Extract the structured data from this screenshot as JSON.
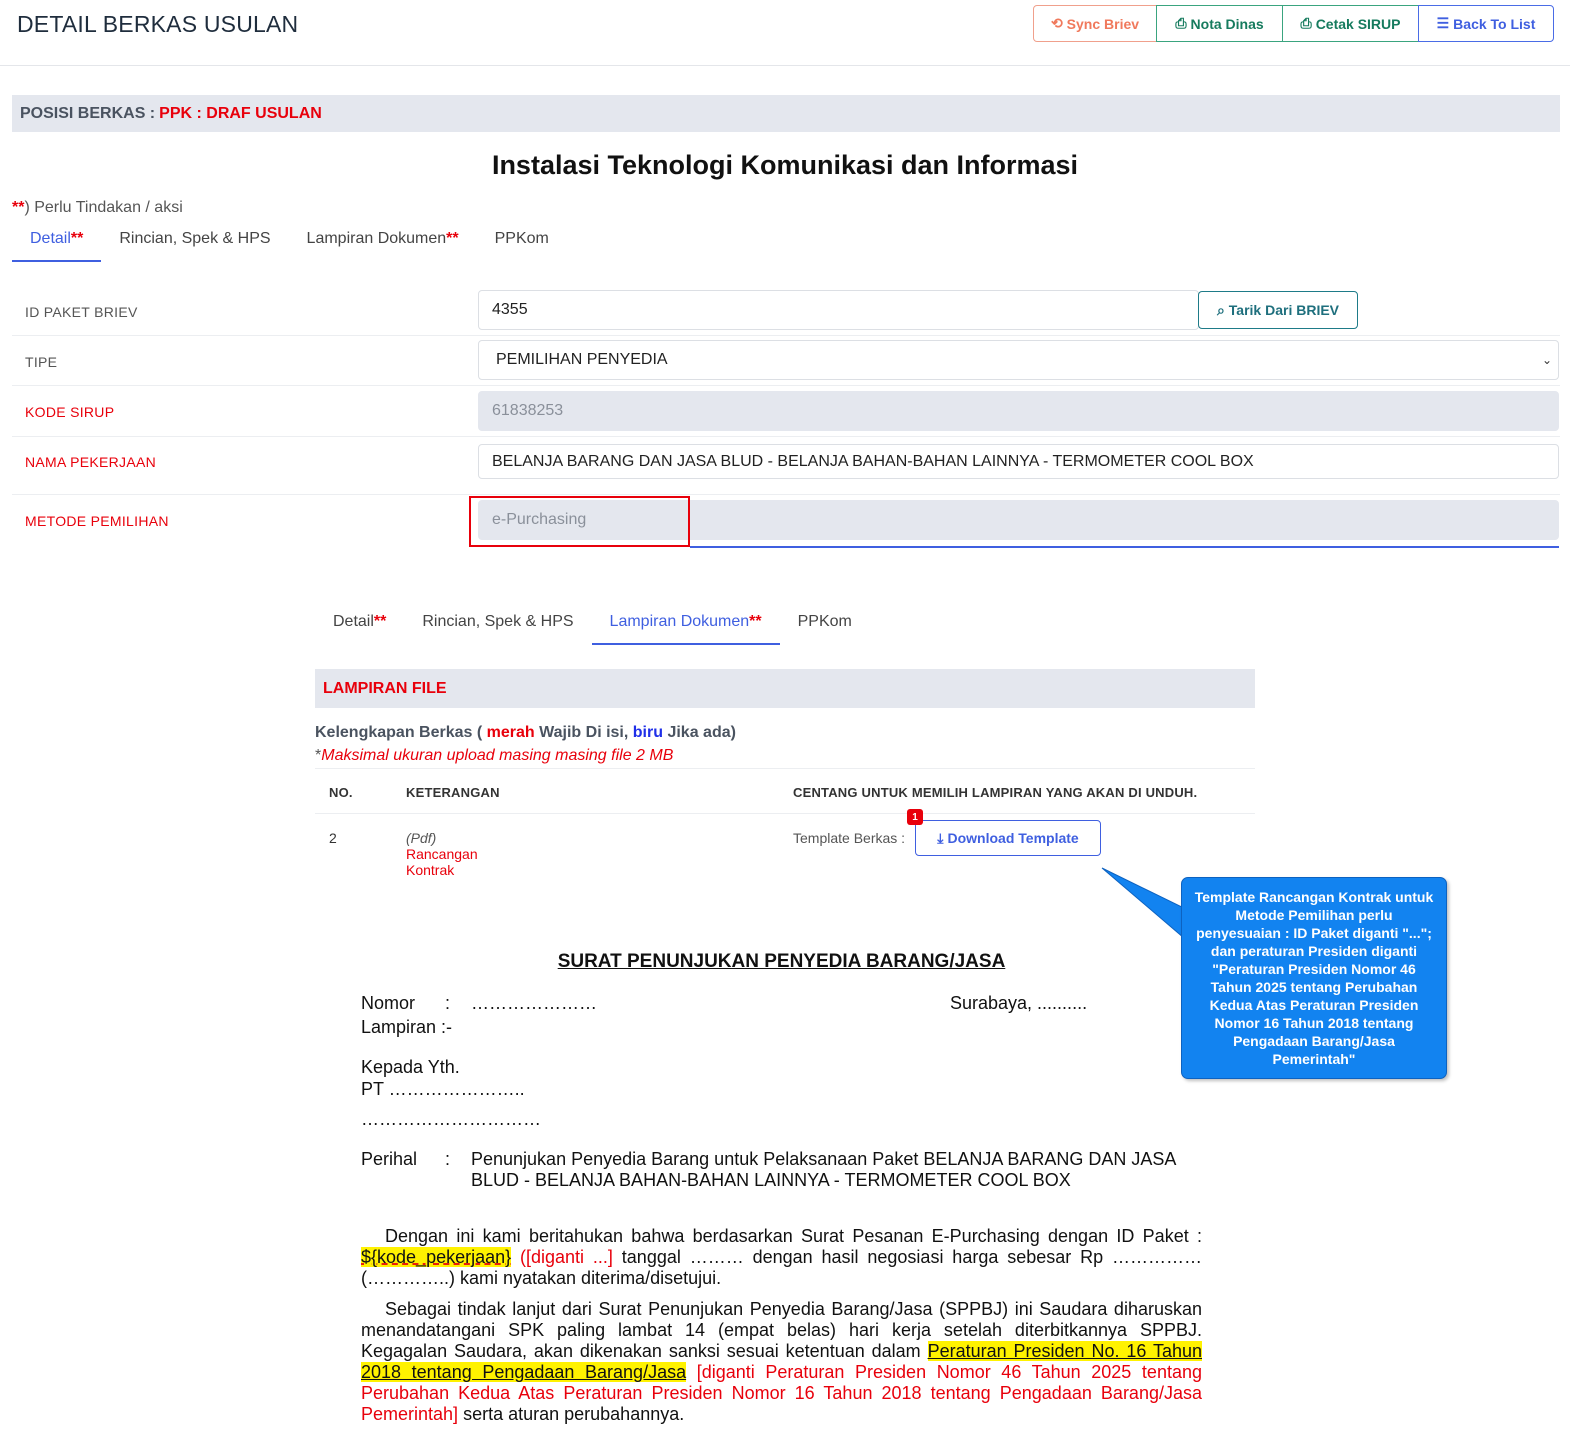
{
  "header": {
    "title": "DETAIL BERKAS USULAN",
    "buttons": {
      "sync": "Sync Briev",
      "nota": "Nota Dinas",
      "sirup": "Cetak SIRUP",
      "back": "Back To List"
    }
  },
  "position": {
    "label": "POSISI BERKAS :",
    "value": "PPK : DRAF USULAN"
  },
  "unit_title": "Instalasi Teknologi Komunikasi dan Informasi",
  "note": {
    "star": "**",
    "text": ") Perlu Tindakan / aksi"
  },
  "tabs": [
    {
      "label": "Detail",
      "star": "**"
    },
    {
      "label": "Rincian, Spek & HPS",
      "star": ""
    },
    {
      "label": "Lampiran Dokumen",
      "star": "**"
    },
    {
      "label": "PPKom",
      "star": ""
    }
  ],
  "form": {
    "id_paket": {
      "label": "ID PAKET BRIEV",
      "value": "4355",
      "button": "Tarik Dari BRIEV"
    },
    "tipe": {
      "label": "TIPE",
      "value": "PEMILIHAN PENYEDIA"
    },
    "kode_sirup": {
      "label": "KODE SIRUP",
      "value": "61838253"
    },
    "nama_pekerjaan": {
      "label": "NAMA PEKERJAAN",
      "value": "BELANJA BARANG DAN JASA BLUD - BELANJA BAHAN-BAHAN LAINNYA - TERMOMETER COOL BOX"
    },
    "metode": {
      "label": "METODE PEMILIHAN",
      "value": "e-Purchasing"
    }
  },
  "lampiran": {
    "title": "LAMPIRAN FILE",
    "kel_prefix": "Kelengkapan Berkas (",
    "kel_merah": "merah",
    "kel_mid": "Wajib Di isi,",
    "kel_biru": "biru",
    "kel_suffix": "Jika ada)",
    "maks_star": "*",
    "maks": "Maksimal ukuran upload masing masing file 2 MB",
    "headers": {
      "no": "NO.",
      "ket": "KETERANGAN",
      "centang": "CENTANG UNTUK MEMILIH LAMPIRAN YANG AKAN DI UNDUH."
    },
    "row": {
      "no": "2",
      "ket": "Rancangan Kontrak",
      "fmt": "(Pdf)",
      "tpl_label": "Template Berkas :",
      "button": "Download Template",
      "badge": "1"
    }
  },
  "callout": "Template Rancangan Kontrak untuk Metode Pemilihan perlu penyesuaian : ID Paket diganti \"...\"; dan peraturan Presiden diganti \"Peraturan Presiden Nomor 46 Tahun 2025 tentang Perubahan Kedua Atas Peraturan Presiden Nomor 16 Tahun 2018 tentang Pengadaan Barang/Jasa Pemerintah\"",
  "letter": {
    "title": "SURAT PENUNJUKAN PENYEDIA BARANG/JASA",
    "nomor_label": "Nomor",
    "nomor_value": "…………………",
    "colon": ":",
    "city": "Surabaya, ..........",
    "lampiran": "Lampiran :-",
    "kepada": "Kepada Yth.",
    "pt": "PT …………………..",
    "addr": "…………………………",
    "perihal_label": "Perihal",
    "perihal_1": "Penunjukan Penyedia Barang untuk Pelaksanaan Paket BELANJA BARANG DAN JASA",
    "perihal_2": "BLUD - BELANJA BAHAN-BAHAN LAINNYA - TERMOMETER COOL BOX",
    "p1_a": "Dengan ini kami beritahukan bahwa berdasarkan Surat Pesanan E-Purchasing dengan ID Paket :",
    "p1_var": "${kode_pekerjaan}",
    "p1_red": "([diganti ...]",
    "p1_b": "tanggal ……… dengan hasil negosiasi harga sebesar Rp …………… (…………..) kami nyatakan diterima/disetujui.",
    "p2_a": "Sebagai tindak lanjut dari Surat Penunjukan Penyedia Barang/Jasa (SPPBJ) ini Saudara diharuskan menandatangani SPK paling lambat 14 (empat belas) hari kerja setelah diterbitkannya SPPBJ. Kegagalan Saudara, akan dikenakan sanksi sesuai ketentuan dalam",
    "p2_hl": "Peraturan Presiden No. 16 Tahun 2018 tentang Pengadaan Barang/Jasa",
    "p2_red": "[diganti Peraturan Presiden Nomor 46 Tahun 2025 tentang Perubahan Kedua Atas Peraturan Presiden Nomor 16 Tahun 2018 tentang Pengadaan Barang/Jasa Pemerintah]",
    "p2_b": "serta aturan perubahannya."
  }
}
